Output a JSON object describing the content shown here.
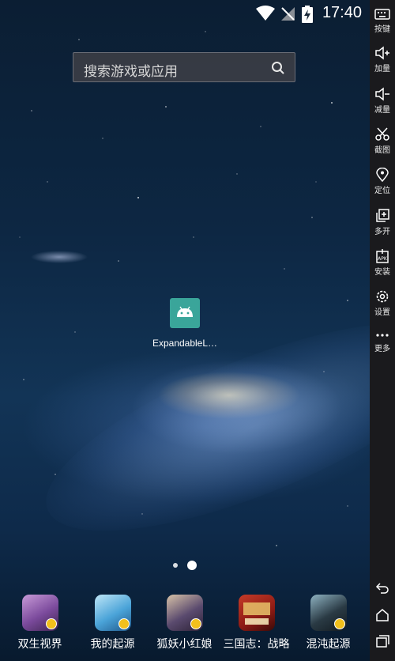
{
  "status_bar": {
    "time": "17:40"
  },
  "search": {
    "placeholder": "搜索游戏或应用"
  },
  "desktop_app": {
    "label": "ExpandableL…"
  },
  "page_indicator": {
    "pages": 2,
    "current": 2
  },
  "dock": [
    {
      "label": "双生视界",
      "color": "#7b4a9c"
    },
    {
      "label": "我的起源",
      "color": "#4aa3d8"
    },
    {
      "label": "狐妖小红娘",
      "color": "#5a4a6e"
    },
    {
      "label": "三国志：战略",
      "color": "#8b1a14"
    },
    {
      "label": "混沌起源",
      "color": "#2a3a44"
    }
  ],
  "sidebar": {
    "items": [
      {
        "label": "按键",
        "icon": "keyboard-icon"
      },
      {
        "label": "加量",
        "icon": "volume-up-icon"
      },
      {
        "label": "减量",
        "icon": "volume-down-icon"
      },
      {
        "label": "截图",
        "icon": "scissors-icon"
      },
      {
        "label": "定位",
        "icon": "location-icon"
      },
      {
        "label": "多开",
        "icon": "multi-open-icon"
      },
      {
        "label": "安装",
        "icon": "apk-install-icon"
      },
      {
        "label": "设置",
        "icon": "gear-icon"
      },
      {
        "label": "更多",
        "icon": "more-icon"
      }
    ]
  }
}
